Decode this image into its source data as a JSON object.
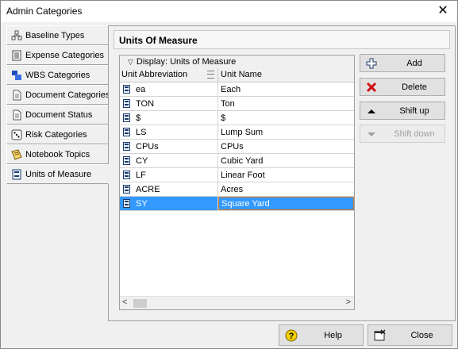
{
  "window": {
    "title": "Admin Categories",
    "close_icon": "close-icon"
  },
  "tabs": [
    {
      "label": "Baseline Types",
      "icon": "baseline-types-icon"
    },
    {
      "label": "Expense Categories",
      "icon": "expense-categories-icon"
    },
    {
      "label": "WBS Categories",
      "icon": "wbs-categories-icon"
    },
    {
      "label": "Document Categories",
      "icon": "document-categories-icon"
    },
    {
      "label": "Document Status",
      "icon": "document-status-icon"
    },
    {
      "label": "Risk Categories",
      "icon": "risk-categories-icon"
    },
    {
      "label": "Notebook Topics",
      "icon": "notebook-topics-icon"
    },
    {
      "label": "Units of Measure",
      "icon": "units-of-measure-icon",
      "selected": true
    }
  ],
  "panel": {
    "title": "Units Of Measure",
    "group_header": "Display: Units of Measure",
    "columns": [
      "Unit Abbreviation",
      "Unit Name"
    ],
    "rows": [
      {
        "abbr": "ea",
        "name": "Each"
      },
      {
        "abbr": "TON",
        "name": "Ton"
      },
      {
        "abbr": "$",
        "name": "$"
      },
      {
        "abbr": "LS",
        "name": "Lump Sum"
      },
      {
        "abbr": "CPUs",
        "name": "CPUs"
      },
      {
        "abbr": "CY",
        "name": "Cubic Yard"
      },
      {
        "abbr": "LF",
        "name": "Linear Foot"
      },
      {
        "abbr": "ACRE",
        "name": "Acres"
      },
      {
        "abbr": "SY",
        "name": "Square Yard",
        "selected": true
      }
    ],
    "buttons": {
      "add": "Add",
      "delete": "Delete",
      "shift_up": "Shift up",
      "shift_down": "Shift down"
    }
  },
  "footer": {
    "help": "Help",
    "close": "Close"
  },
  "colors": {
    "selection": "#3399ff",
    "edit_border": "#d07a2a"
  }
}
